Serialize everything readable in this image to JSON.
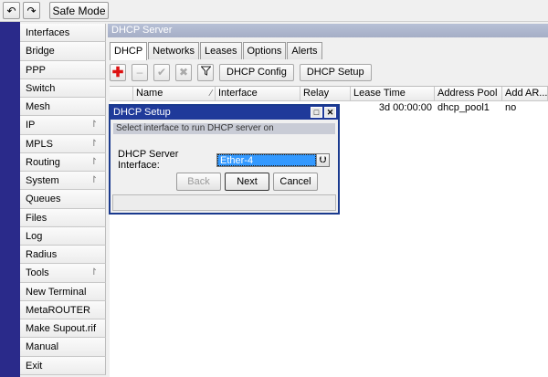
{
  "topbar": {
    "undo_icon": "undo-icon",
    "redo_icon": "redo-icon",
    "safe_mode_label": "Safe Mode"
  },
  "sidebar": {
    "items": [
      {
        "label": "Interfaces",
        "submenu": false
      },
      {
        "label": "Bridge",
        "submenu": false
      },
      {
        "label": "PPP",
        "submenu": false
      },
      {
        "label": "Switch",
        "submenu": false
      },
      {
        "label": "Mesh",
        "submenu": false
      },
      {
        "label": "IP",
        "submenu": true
      },
      {
        "label": "MPLS",
        "submenu": true
      },
      {
        "label": "Routing",
        "submenu": true
      },
      {
        "label": "System",
        "submenu": true
      },
      {
        "label": "Queues",
        "submenu": false
      },
      {
        "label": "Files",
        "submenu": false
      },
      {
        "label": "Log",
        "submenu": false
      },
      {
        "label": "Radius",
        "submenu": false
      },
      {
        "label": "Tools",
        "submenu": true
      },
      {
        "label": "New Terminal",
        "submenu": false
      },
      {
        "label": "MetaROUTER",
        "submenu": false
      },
      {
        "label": "Make Supout.rif",
        "submenu": false
      },
      {
        "label": "Manual",
        "submenu": false
      },
      {
        "label": "Exit",
        "submenu": false
      }
    ]
  },
  "main": {
    "title": "DHCP Server",
    "tabs": [
      {
        "label": "DHCP",
        "active": true
      },
      {
        "label": "Networks",
        "active": false
      },
      {
        "label": "Leases",
        "active": false
      },
      {
        "label": "Options",
        "active": false
      },
      {
        "label": "Alerts",
        "active": false
      }
    ],
    "toolbar": {
      "dhcp_config_label": "DHCP Config",
      "dhcp_setup_label": "DHCP Setup"
    },
    "table": {
      "columns": [
        "Name",
        "Interface",
        "Relay",
        "Lease Time",
        "Address Pool",
        "Add AR..."
      ],
      "rows": [
        {
          "name": "",
          "interface": "",
          "relay": "",
          "lease_time": "3d 00:00:00",
          "address_pool": "dhcp_pool1",
          "add_arp": "no"
        }
      ]
    }
  },
  "dialog": {
    "title": "DHCP Setup",
    "hint": "Select interface to run DHCP server on",
    "field_label": "DHCP Server Interface:",
    "field_value": "Ether-4",
    "back_label": "Back",
    "next_label": "Next",
    "cancel_label": "Cancel"
  }
}
